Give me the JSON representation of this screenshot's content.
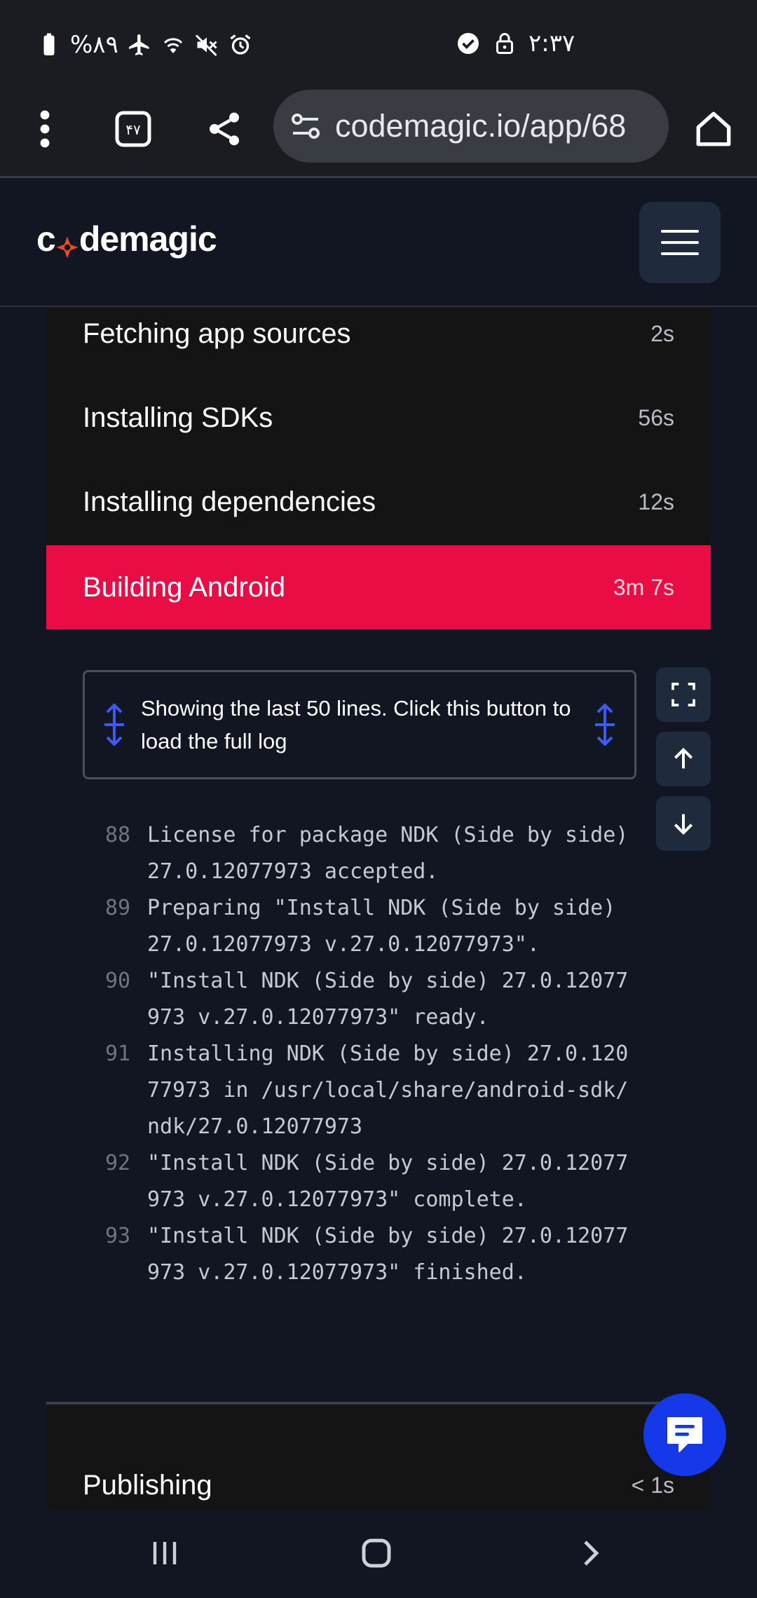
{
  "status_bar": {
    "battery_percent": "%۸۹",
    "time": "۲:۳۷"
  },
  "browser": {
    "tab_count": "۴۷",
    "url": "codemagic.io/app/68"
  },
  "site": {
    "logo_left": "c",
    "logo_right": "demagic"
  },
  "steps": [
    {
      "name": "Fetching app sources",
      "time": "2s"
    },
    {
      "name": "Installing SDKs",
      "time": "56s"
    },
    {
      "name": "Installing dependencies",
      "time": "12s"
    },
    {
      "name": "Building Android",
      "time": "3m 7s"
    }
  ],
  "log": {
    "notice": "Showing the last 50 lines. Click this button to load the full log",
    "lines": [
      {
        "num": "88",
        "text": "License for package NDK (Side by side) 27.0.12077973 accepted."
      },
      {
        "num": "89",
        "text": "Preparing \"Install NDK (Side by side) 27.0.12077973 v.27.0.12077973\"."
      },
      {
        "num": "90",
        "text": "\"Install NDK (Side by side) 27.0.12077973 v.27.0.12077973\" ready."
      },
      {
        "num": "91",
        "text": "Installing NDK (Side by side) 27.0.12077973 in /usr/local/share/android-sdk/ndk/27.0.12077973"
      },
      {
        "num": "92",
        "text": "\"Install NDK (Side by side) 27.0.12077973 v.27.0.12077973\" complete."
      },
      {
        "num": "93",
        "text": "\"Install NDK (Side by side) 27.0.12077973 v.27.0.12077973\" finished."
      }
    ]
  },
  "publishing": {
    "name": "Publishing",
    "time": "< 1s"
  },
  "colors": {
    "accent": "#ea0c44",
    "chat": "#1538e8",
    "background": "#121622",
    "expand_icon": "#3b5cf0"
  }
}
